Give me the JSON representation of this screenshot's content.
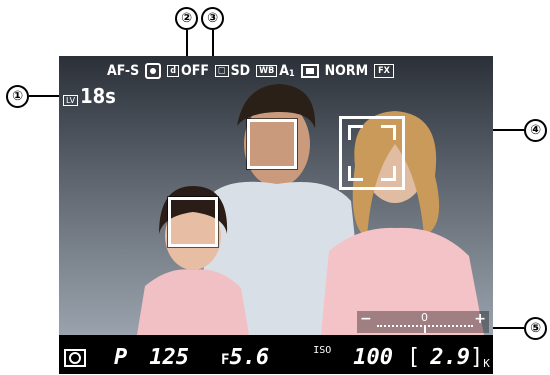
{
  "callouts": [
    "①",
    "②",
    "③",
    "④",
    "⑤"
  ],
  "top_bar": {
    "focus_mode": "AF-S",
    "af_area_icon": "face-priority-af-icon",
    "d_lighting_icon": "active-d-lighting-icon",
    "d_lighting": "OFF",
    "picture_control_icon": "picture-control-icon",
    "picture_control": "SD",
    "wb_icon": "WB",
    "wb_value": "A",
    "wb_sub": "1",
    "image_size_icon": "image-size-icon",
    "image_quality": "NORM",
    "image_area": "FX"
  },
  "lv_indicator": {
    "icon": "LV",
    "time": "18s"
  },
  "exposure_indicator": {
    "minus": "−",
    "plus": "+",
    "center": "0"
  },
  "bottom_bar": {
    "metering_icon": "matrix-metering-icon",
    "mode": "P",
    "shutter": "125",
    "aperture_prefix": "F",
    "aperture": "5.6",
    "iso_label": "ISO",
    "iso": "100",
    "bracket_left": "[",
    "remaining": "2.9",
    "remaining_unit": "K"
  }
}
